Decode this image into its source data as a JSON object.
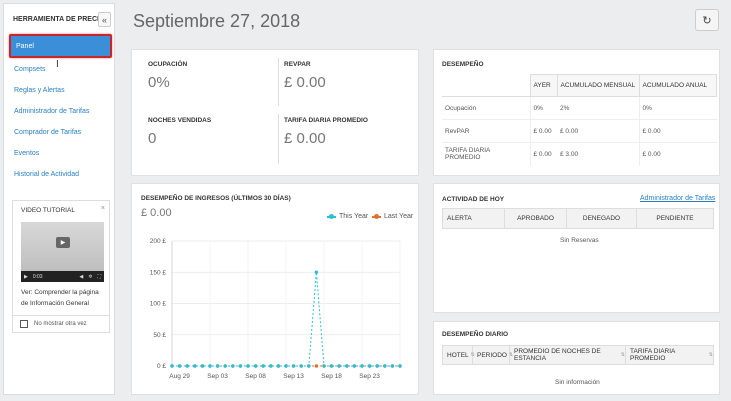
{
  "sidebar": {
    "title": "HERRAMIENTA DE PRECIOS",
    "collapse_glyph": "«",
    "items": [
      {
        "label": "Panel"
      },
      {
        "label": "Compsets"
      },
      {
        "label": "Reglas y Alertas"
      },
      {
        "label": "Administrador de Tarifas"
      },
      {
        "label": "Comprador de Tarifas"
      },
      {
        "label": "Eventos"
      },
      {
        "label": "Historial de Actividad"
      }
    ]
  },
  "video_tutorial": {
    "title": "VIDEO TUTORIAL",
    "close_glyph": "×",
    "time": "0:03",
    "caption": "Ver: Comprender la página de Información General",
    "dont_show": "No mostrar otra vez"
  },
  "header": {
    "date": "Septiembre 27, 2018",
    "refresh_glyph": "↻"
  },
  "kpis": {
    "occupancy_label": "OCUPACIÓN",
    "occupancy_value": "0%",
    "revpar_label": "REVPAR",
    "revpar_value": "£ 0.00",
    "nights_label": "NOCHES VENDIDAS",
    "nights_value": "0",
    "adr_label": "TARIFA DIARIA PROMEDIO",
    "adr_value": "£ 0.00"
  },
  "performance": {
    "title": "DESEMPEÑO",
    "columns": [
      "",
      "AYER",
      "ACUMULADO MENSUAL",
      "ACUMULADO ANUAL"
    ],
    "rows": [
      [
        "Ocupación",
        "0%",
        "2%",
        "0%"
      ],
      [
        "RevPAR",
        "£ 0.00",
        "£ 0.00",
        "£ 0.00"
      ],
      [
        "TARIFA DIARIA PROMEDIO",
        "£ 0.00",
        "£ 3.00",
        "£ 0.00"
      ]
    ]
  },
  "revenue": {
    "title": "DESEMPEÑO DE INGRESOS (ÚLTIMOS 30 DÍAS)",
    "value": "£ 0.00"
  },
  "chart_data": {
    "type": "line",
    "title": "DESEMPEÑO DE INGRESOS (ÚLTIMOS 30 DÍAS)",
    "xlabel": "",
    "ylabel": "",
    "ylim": [
      0,
      200
    ],
    "yticks": [
      "0 £",
      "50 £",
      "100 £",
      "150 £",
      "200 £"
    ],
    "ytick_values": [
      0,
      50,
      100,
      150,
      200
    ],
    "xtick_labels": [
      "Aug 29",
      "Sep 03",
      "Sep 08",
      "Sep 13",
      "Sep 18",
      "Sep 23"
    ],
    "xtick_index": [
      1,
      6,
      11,
      16,
      21,
      26
    ],
    "grid": true,
    "legend_placement": "top-right",
    "series": [
      {
        "name": "This Year",
        "color": "#2bbfd6",
        "style": "dashed",
        "values": [
          0,
          0,
          0,
          0,
          0,
          0,
          0,
          0,
          0,
          0,
          0,
          0,
          0,
          0,
          0,
          0,
          0,
          0,
          0,
          150,
          0,
          0,
          0,
          0,
          0,
          0,
          0,
          0,
          0,
          0,
          0
        ]
      },
      {
        "name": "Last Year",
        "color": "#e4702a",
        "style": "dashed",
        "values": [
          0,
          0,
          0,
          0,
          0,
          0,
          0,
          0,
          0,
          0,
          0,
          0,
          0,
          0,
          0,
          0,
          0,
          0,
          0,
          0,
          0,
          0,
          0,
          0,
          0,
          0,
          0,
          0,
          0,
          0,
          0
        ]
      }
    ]
  },
  "activity": {
    "title": "ACTIVIDAD DE HOY",
    "link": "Administrador de Tarifas",
    "columns": [
      "ALERTA",
      "APROBADO",
      "DENEGADO",
      "PENDIENTE"
    ],
    "empty": "Sin Reservas"
  },
  "daily": {
    "title": "DESEMPEÑO DIARIO",
    "columns": [
      "HOTEL",
      "PERIODO",
      "PROMEDIO DE NOCHES DE ESTANCIA",
      "TARIFA DIARIA PROMEDIO"
    ],
    "empty": "Sin información"
  }
}
